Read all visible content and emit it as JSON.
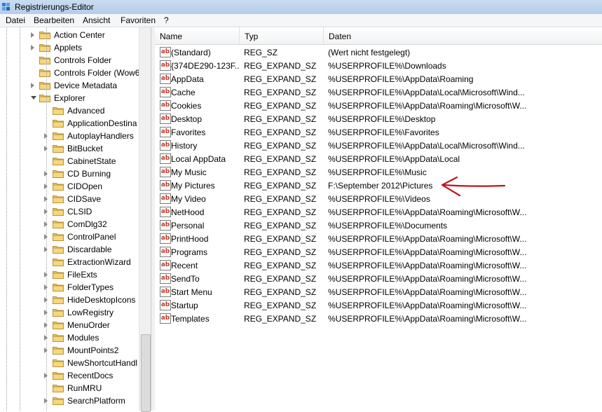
{
  "window": {
    "title": "Registrierungs-Editor"
  },
  "menu": [
    "Datei",
    "Bearbeiten",
    "Ansicht",
    "Favoriten",
    "?"
  ],
  "tree": {
    "items": [
      {
        "label": "Action Center",
        "level": 1,
        "expand": "closed"
      },
      {
        "label": "Applets",
        "level": 1,
        "expand": "closed"
      },
      {
        "label": "Controls Folder",
        "level": 1,
        "expand": "none"
      },
      {
        "label": "Controls Folder (Wow6",
        "level": 1,
        "expand": "none"
      },
      {
        "label": "Device Metadata",
        "level": 1,
        "expand": "closed"
      },
      {
        "label": "Explorer",
        "level": 1,
        "expand": "open"
      },
      {
        "label": "Advanced",
        "level": 2,
        "expand": "none"
      },
      {
        "label": "ApplicationDestina",
        "level": 2,
        "expand": "none"
      },
      {
        "label": "AutoplayHandlers",
        "level": 2,
        "expand": "closed"
      },
      {
        "label": "BitBucket",
        "level": 2,
        "expand": "closed"
      },
      {
        "label": "CabinetState",
        "level": 2,
        "expand": "none"
      },
      {
        "label": "CD Burning",
        "level": 2,
        "expand": "closed"
      },
      {
        "label": "CIDOpen",
        "level": 2,
        "expand": "closed"
      },
      {
        "label": "CIDSave",
        "level": 2,
        "expand": "closed"
      },
      {
        "label": "CLSID",
        "level": 2,
        "expand": "closed"
      },
      {
        "label": "ComDlg32",
        "level": 2,
        "expand": "closed"
      },
      {
        "label": "ControlPanel",
        "level": 2,
        "expand": "closed"
      },
      {
        "label": "Discardable",
        "level": 2,
        "expand": "closed"
      },
      {
        "label": "ExtractionWizard",
        "level": 2,
        "expand": "none"
      },
      {
        "label": "FileExts",
        "level": 2,
        "expand": "closed"
      },
      {
        "label": "FolderTypes",
        "level": 2,
        "expand": "closed"
      },
      {
        "label": "HideDesktopIcons",
        "level": 2,
        "expand": "closed"
      },
      {
        "label": "LowRegistry",
        "level": 2,
        "expand": "closed"
      },
      {
        "label": "MenuOrder",
        "level": 2,
        "expand": "closed"
      },
      {
        "label": "Modules",
        "level": 2,
        "expand": "closed"
      },
      {
        "label": "MountPoints2",
        "level": 2,
        "expand": "closed"
      },
      {
        "label": "NewShortcutHandl",
        "level": 2,
        "expand": "none"
      },
      {
        "label": "RecentDocs",
        "level": 2,
        "expand": "closed"
      },
      {
        "label": "RunMRU",
        "level": 2,
        "expand": "none"
      },
      {
        "label": "SearchPlatform",
        "level": 2,
        "expand": "closed"
      }
    ]
  },
  "list": {
    "columns": [
      "Name",
      "Typ",
      "Daten"
    ],
    "value_icon": "ab",
    "rows": [
      {
        "name": "(Standard)",
        "type": "REG_SZ",
        "data": "(Wert nicht festgelegt)"
      },
      {
        "name": "{374DE290-123F...",
        "type": "REG_EXPAND_SZ",
        "data": "%USERPROFILE%\\Downloads"
      },
      {
        "name": "AppData",
        "type": "REG_EXPAND_SZ",
        "data": "%USERPROFILE%\\AppData\\Roaming"
      },
      {
        "name": "Cache",
        "type": "REG_EXPAND_SZ",
        "data": "%USERPROFILE%\\AppData\\Local\\Microsoft\\Wind..."
      },
      {
        "name": "Cookies",
        "type": "REG_EXPAND_SZ",
        "data": "%USERPROFILE%\\AppData\\Roaming\\Microsoft\\W..."
      },
      {
        "name": "Desktop",
        "type": "REG_EXPAND_SZ",
        "data": "%USERPROFILE%\\Desktop"
      },
      {
        "name": "Favorites",
        "type": "REG_EXPAND_SZ",
        "data": "%USERPROFILE%\\Favorites"
      },
      {
        "name": "History",
        "type": "REG_EXPAND_SZ",
        "data": "%USERPROFILE%\\AppData\\Local\\Microsoft\\Wind..."
      },
      {
        "name": "Local AppData",
        "type": "REG_EXPAND_SZ",
        "data": "%USERPROFILE%\\AppData\\Local"
      },
      {
        "name": "My Music",
        "type": "REG_EXPAND_SZ",
        "data": "%USERPROFILE%\\Music"
      },
      {
        "name": "My Pictures",
        "type": "REG_EXPAND_SZ",
        "data": "F:\\September 2012\\Pictures"
      },
      {
        "name": "My Video",
        "type": "REG_EXPAND_SZ",
        "data": "%USERPROFILE%\\Videos"
      },
      {
        "name": "NetHood",
        "type": "REG_EXPAND_SZ",
        "data": "%USERPROFILE%\\AppData\\Roaming\\Microsoft\\W..."
      },
      {
        "name": "Personal",
        "type": "REG_EXPAND_SZ",
        "data": "%USERPROFILE%\\Documents"
      },
      {
        "name": "PrintHood",
        "type": "REG_EXPAND_SZ",
        "data": "%USERPROFILE%\\AppData\\Roaming\\Microsoft\\W..."
      },
      {
        "name": "Programs",
        "type": "REG_EXPAND_SZ",
        "data": "%USERPROFILE%\\AppData\\Roaming\\Microsoft\\W..."
      },
      {
        "name": "Recent",
        "type": "REG_EXPAND_SZ",
        "data": "%USERPROFILE%\\AppData\\Roaming\\Microsoft\\W..."
      },
      {
        "name": "SendTo",
        "type": "REG_EXPAND_SZ",
        "data": "%USERPROFILE%\\AppData\\Roaming\\Microsoft\\W..."
      },
      {
        "name": "Start Menu",
        "type": "REG_EXPAND_SZ",
        "data": "%USERPROFILE%\\AppData\\Roaming\\Microsoft\\W..."
      },
      {
        "name": "Startup",
        "type": "REG_EXPAND_SZ",
        "data": "%USERPROFILE%\\AppData\\Roaming\\Microsoft\\W..."
      },
      {
        "name": "Templates",
        "type": "REG_EXPAND_SZ",
        "data": "%USERPROFILE%\\AppData\\Roaming\\Microsoft\\W..."
      }
    ]
  },
  "annotation": {
    "kind": "hand-drawn-arrow",
    "color": "#c0141b",
    "points_to_row": "My Pictures"
  }
}
